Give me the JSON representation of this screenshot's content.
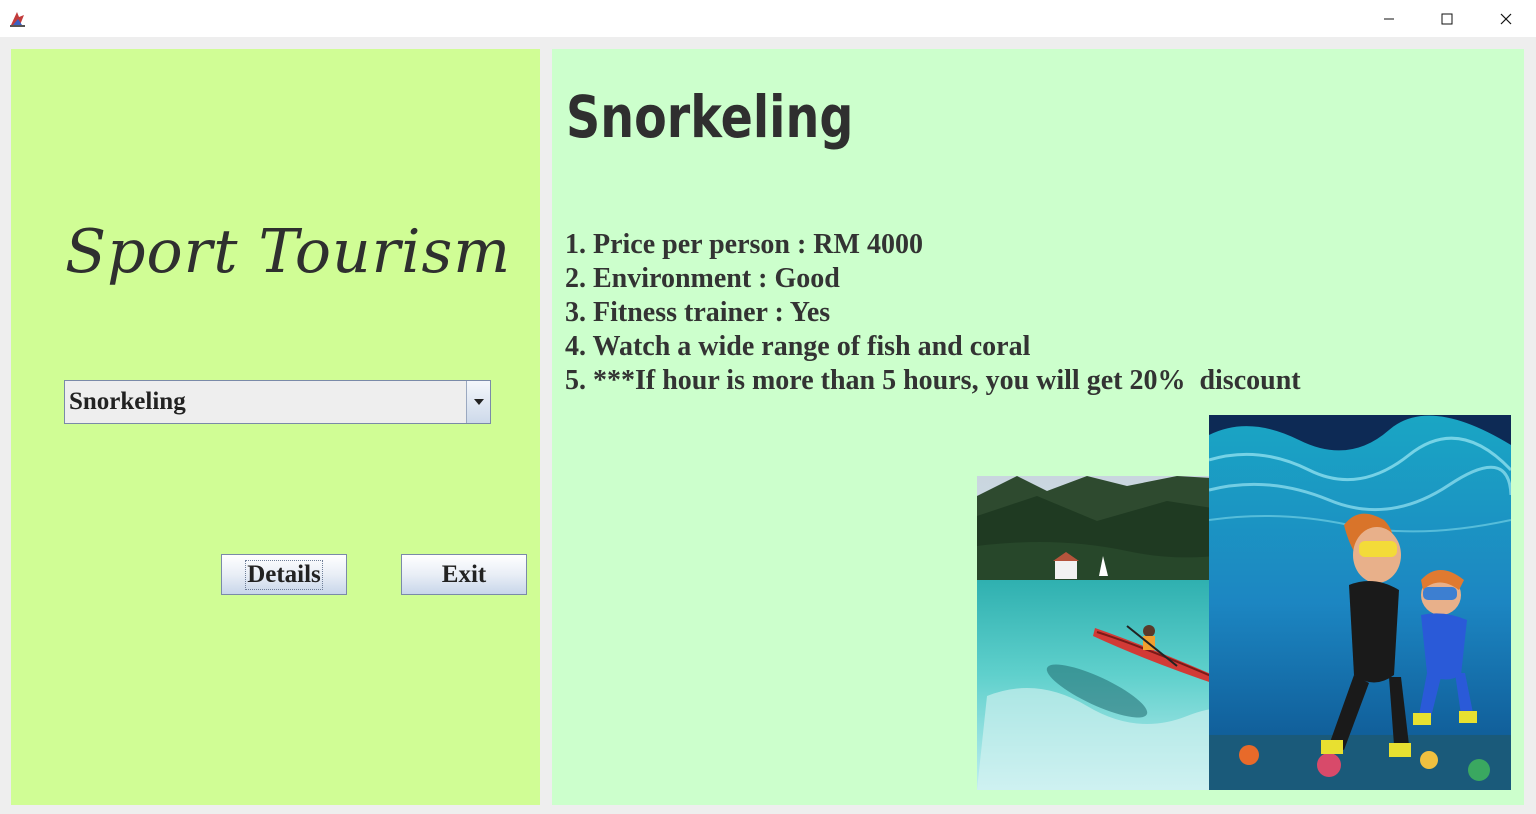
{
  "window": {
    "minimize_icon": "minimize-icon",
    "maximize_icon": "maximize-icon",
    "close_icon": "close-icon"
  },
  "left": {
    "brand_title": "Sport Tourism",
    "combo": {
      "selected": "Snorkeling",
      "arrow_icon": "chevron-down-icon"
    },
    "details_button": "Details",
    "exit_button": "Exit"
  },
  "right": {
    "activity_title": "Snorkeling",
    "details": [
      "1. Price per person : RM 4000",
      "2. Environment : Good",
      "3. Fitness trainer : Yes",
      "4. Watch a wide range of fish and coral",
      "5. ***If hour is more than 5 hours, you will get 20%  discount"
    ]
  },
  "colors": {
    "left_panel_bg": "#d0fd95",
    "right_panel_bg": "#ccffcc",
    "window_bg": "#eeeeee"
  }
}
